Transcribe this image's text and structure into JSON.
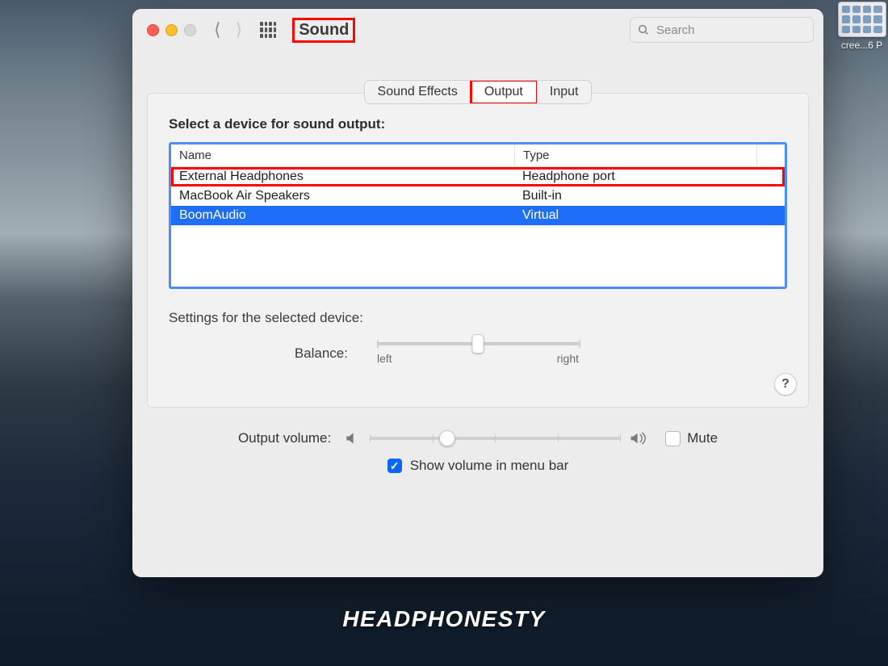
{
  "toolbar": {
    "title": "Sound",
    "search_placeholder": "Search"
  },
  "tabs": {
    "sound_effects": "Sound Effects",
    "output": "Output",
    "input": "Input",
    "active": "output"
  },
  "output": {
    "heading": "Select a device for sound output:",
    "columns": {
      "name": "Name",
      "type": "Type"
    },
    "devices": [
      {
        "name": "External Headphones",
        "type": "Headphone port",
        "selected": false,
        "highlighted": true
      },
      {
        "name": "MacBook Air Speakers",
        "type": "Built-in",
        "selected": false,
        "highlighted": false
      },
      {
        "name": "BoomAudio",
        "type": "Virtual",
        "selected": true,
        "highlighted": false
      }
    ],
    "settings_label": "Settings for the selected device:",
    "balance": {
      "label": "Balance:",
      "left_caption": "left",
      "right_caption": "right",
      "value_percent": 50
    },
    "help_symbol": "?"
  },
  "volume": {
    "label": "Output volume:",
    "value_percent": 31,
    "mute_label": "Mute",
    "mute_checked": false,
    "menubar_label": "Show volume in menu bar",
    "menubar_checked": true
  },
  "desktop": {
    "thumb_label": "cree...6 P"
  },
  "watermark": "HEADPHONESTY"
}
